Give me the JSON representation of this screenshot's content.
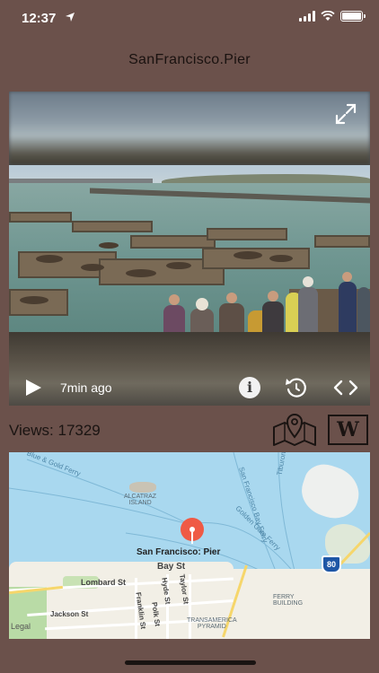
{
  "status_bar": {
    "time": "12:37"
  },
  "header": {
    "title": "SanFrancisco.Pier"
  },
  "video": {
    "time_ago": "7min ago"
  },
  "stats": {
    "views_label": "Views: 17329"
  },
  "wiki_button": {
    "label": "W"
  },
  "map": {
    "pin_label": "San Francisco: Pier",
    "labels": {
      "blue_gold_ferry": "Blue & Gold Ferry",
      "tiburon": "Tiburon",
      "alcatraz": "ALCATRAZ\nISLAND",
      "sf_bay_ferry": "San Francisco Bay Ferry",
      "golden_gate_ferry": "Golden Gate Ferry",
      "bay_st": "Bay St",
      "lombard_st": "Lombard St",
      "hyde_st": "Hyde St",
      "taylor_st": "Taylor St",
      "franklin_st": "Franklin St",
      "polk_st": "Polk St",
      "jackson_st": "Jackson St",
      "ferry_building": "FERRY\nBUILDING",
      "transamerica": "TRANSAMERICA\nPYRAMID",
      "interstate": "80",
      "legal": "Legal"
    }
  },
  "colors": {
    "background": "#6b514b",
    "map_water": "#a9d8ef",
    "pin": "#ef5a45"
  }
}
